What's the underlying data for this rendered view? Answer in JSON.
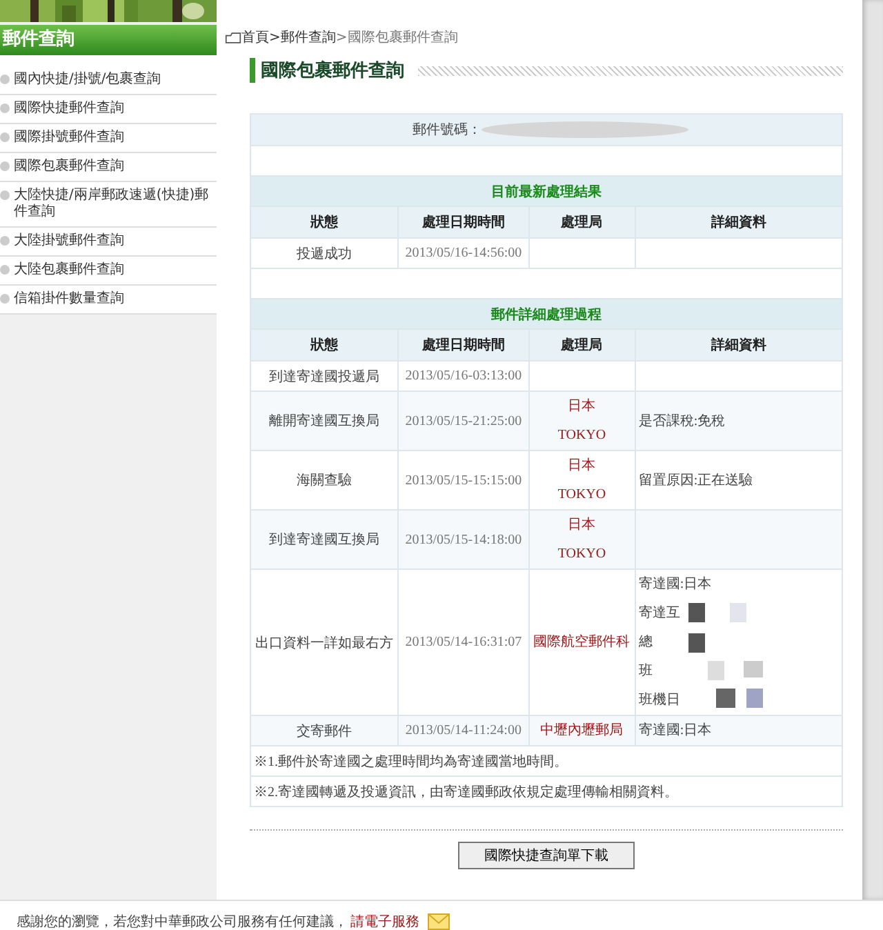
{
  "sidebar": {
    "title": "郵件查詢",
    "items": [
      {
        "label": "國內快捷/掛號/包裹查詢",
        "selected": false
      },
      {
        "label": "國際快捷郵件查詢",
        "selected": false
      },
      {
        "label": "國際掛號郵件查詢",
        "selected": false
      },
      {
        "label": "國際包裹郵件查詢",
        "selected": false
      },
      {
        "label": "大陸快捷/兩岸郵政速遞(快捷)郵件查詢",
        "selected": false
      },
      {
        "label": "大陸掛號郵件查詢",
        "selected": false
      },
      {
        "label": "大陸包裹郵件查詢",
        "selected": false
      },
      {
        "label": "信箱掛件數量查詢",
        "selected": false
      }
    ]
  },
  "breadcrumb": [
    "首頁",
    ">郵件查詢",
    ">國際包裹郵件查詢"
  ],
  "page_title": "國際包裹郵件查詢",
  "tracking": {
    "label": "郵件號碼：",
    "redacted": true
  },
  "latest": {
    "title": "目前最新處理結果",
    "columns": [
      "狀態",
      "處理日期時間",
      "處理局",
      "詳細資料"
    ],
    "rows": [
      {
        "status": "投遞成功",
        "time": "2013/05/16-14:56:00",
        "office": [],
        "details": [],
        "redacted": false
      }
    ]
  },
  "history": {
    "title": "郵件詳細處理過程",
    "columns": [
      "狀態",
      "處理日期時間",
      "處理局",
      "詳細資料"
    ],
    "rows": [
      {
        "status": "到達寄達國投遞局",
        "time": "2013/05/16-03:13:00",
        "office": [],
        "details": [],
        "redacted": false
      },
      {
        "status": "離開寄達國互換局",
        "time": "2013/05/15-21:25:00",
        "office": [
          "日本",
          "TOKYO"
        ],
        "details": [
          "是否課稅:免稅"
        ],
        "redacted": false
      },
      {
        "status": "海關查驗",
        "time": "2013/05/15-15:15:00",
        "office": [
          "日本",
          "TOKYO"
        ],
        "details": [
          "留置原因:正在送驗"
        ],
        "redacted": false
      },
      {
        "status": "到達寄達國互換局",
        "time": "2013/05/15-14:18:00",
        "office": [
          "日本",
          "TOKYO"
        ],
        "details": [],
        "redacted": false
      },
      {
        "status": "出口資料一詳如最右方",
        "time": "2013/05/14-16:31:07",
        "office": [
          "國際航空郵件科"
        ],
        "details": [
          "寄達國:日本",
          "寄達互",
          "總",
          "班",
          "班機日"
        ],
        "redacted": true
      },
      {
        "status": "交寄郵件",
        "time": "2013/05/14-11:24:00",
        "office": [
          "中壢內壢郵局"
        ],
        "details": [
          "寄達國:日本"
        ],
        "redacted": false
      }
    ]
  },
  "notes": [
    "※1.郵件於寄達國之處理時間均為寄達國當地時間。",
    "※2.寄達國轉遞及投遞資訊，由寄達國郵政依規定處理傳輸相關資料。"
  ],
  "download_button": "國際快捷查詢單下載",
  "footer": {
    "text": "感謝您的瀏覽，若您對中華郵政公司服務有任何建議，",
    "link": "請電子服務"
  }
}
